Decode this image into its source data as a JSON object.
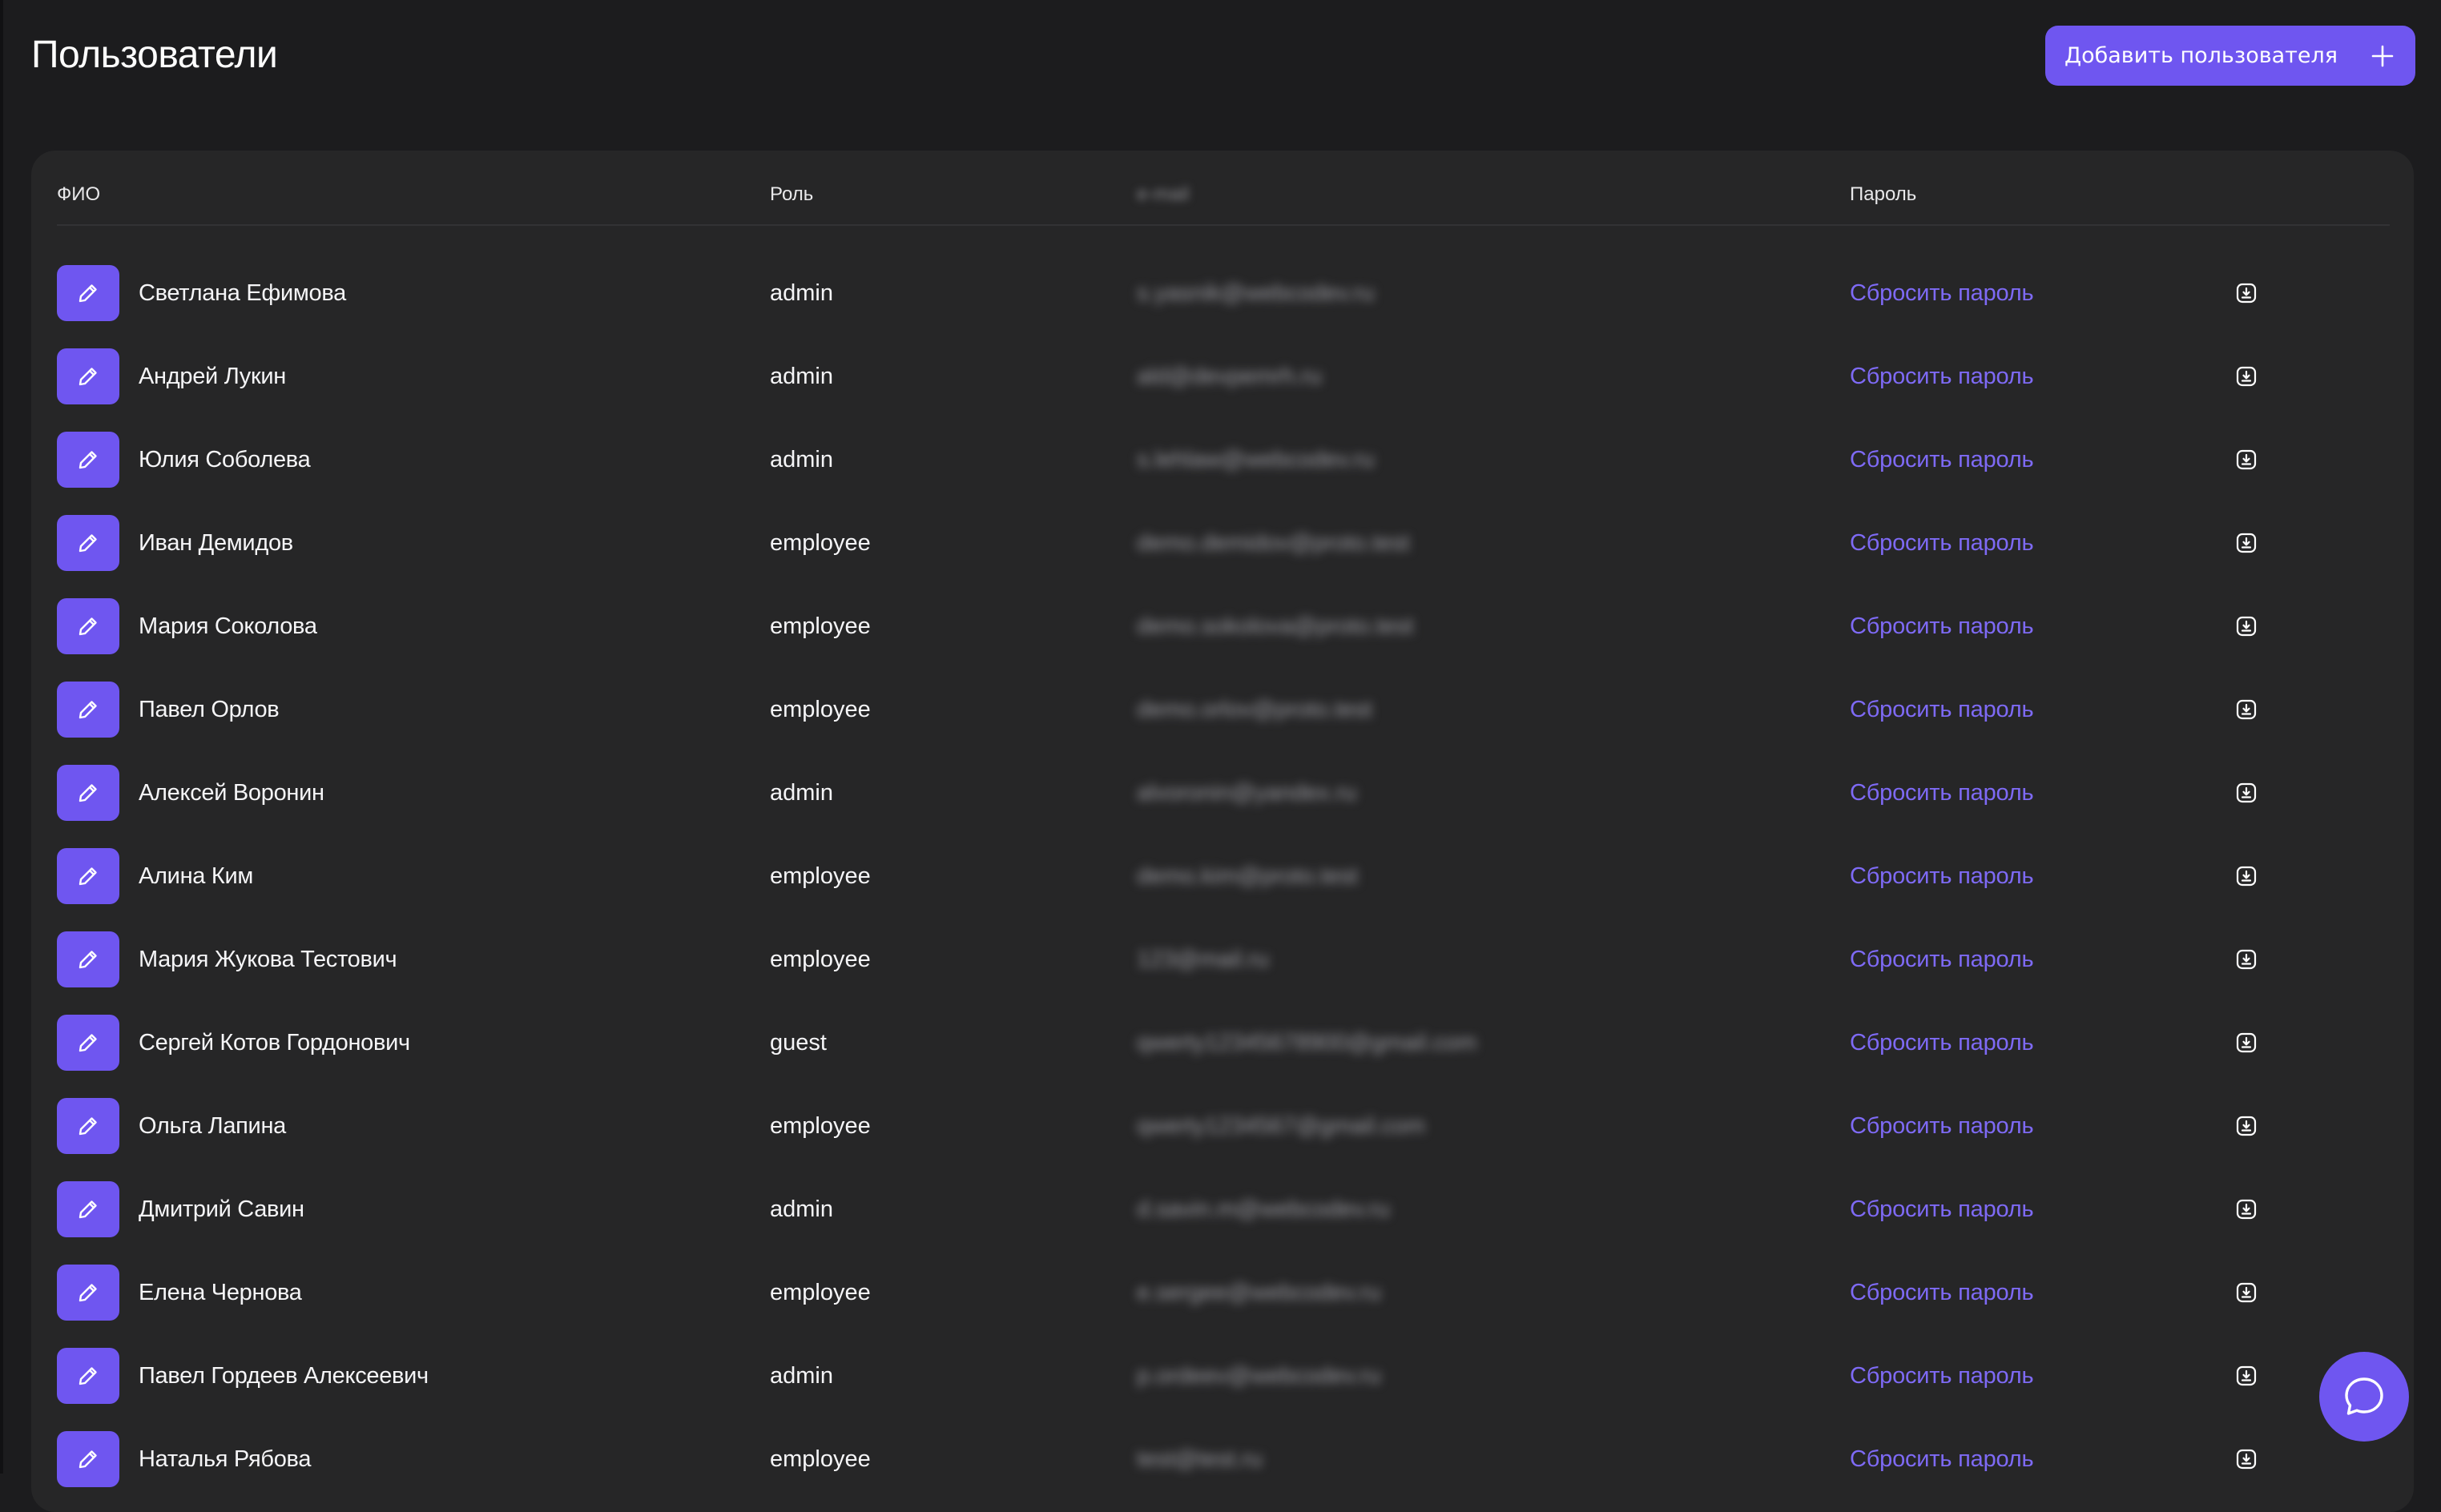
{
  "header": {
    "title": "Пользователи",
    "add_button_label": "Добавить пользователя",
    "add_button_icon": "plus-icon"
  },
  "table": {
    "columns": {
      "name": "ФИО",
      "role": "Роль",
      "email": "e-mail",
      "password": "Пароль"
    },
    "reset_label": "Сбросить пароль",
    "rows": [
      {
        "name": "Светлана Ефимова",
        "role": "admin",
        "email": "s.yasnik@webcodev.ru"
      },
      {
        "name": "Андрей Лукин",
        "role": "admin",
        "email": "ald@devpemrh.ru"
      },
      {
        "name": "Юлия Соболева",
        "role": "admin",
        "email": "s.lehlaw@webcodev.ru"
      },
      {
        "name": "Иван Демидов",
        "role": "employee",
        "email": "demo.demidov@proto.test"
      },
      {
        "name": "Мария Соколова",
        "role": "employee",
        "email": "demo.sokolova@proto.test"
      },
      {
        "name": "Павел Орлов",
        "role": "employee",
        "email": "demo.orlov@proto.test"
      },
      {
        "name": "Алексей Воронин",
        "role": "admin",
        "email": "alvoronin@yandex.ru"
      },
      {
        "name": "Алина Ким",
        "role": "employee",
        "email": "demo.kim@proto.test"
      },
      {
        "name": "Мария Жукова Тестович",
        "role": "employee",
        "email": "123@mail.ru"
      },
      {
        "name": "Сергей Котов Гордонович",
        "role": "guest",
        "email": "qwerty12345678900@gmail.com"
      },
      {
        "name": "Ольга Лапина",
        "role": "employee",
        "email": "qwerty1234567@gmail.com"
      },
      {
        "name": "Дмитрий Савин",
        "role": "admin",
        "email": "d.savin.m@webcodev.ru"
      },
      {
        "name": "Елена Чернова",
        "role": "employee",
        "email": "e.sergee@webcodev.ru"
      },
      {
        "name": "Павел Гордеев Алексеевич",
        "role": "admin",
        "email": "p.ordeev@webcodev.ru"
      },
      {
        "name": "Наталья Рябова",
        "role": "employee",
        "email": "test@test.ru"
      }
    ]
  },
  "colors": {
    "background": "#1c1c1e",
    "panel": "#262627",
    "accent": "#6f56f0",
    "link": "#7e6af5"
  },
  "icons": {
    "edit": "pencil-icon",
    "download": "download-icon",
    "chat": "chat-bubble-icon"
  }
}
